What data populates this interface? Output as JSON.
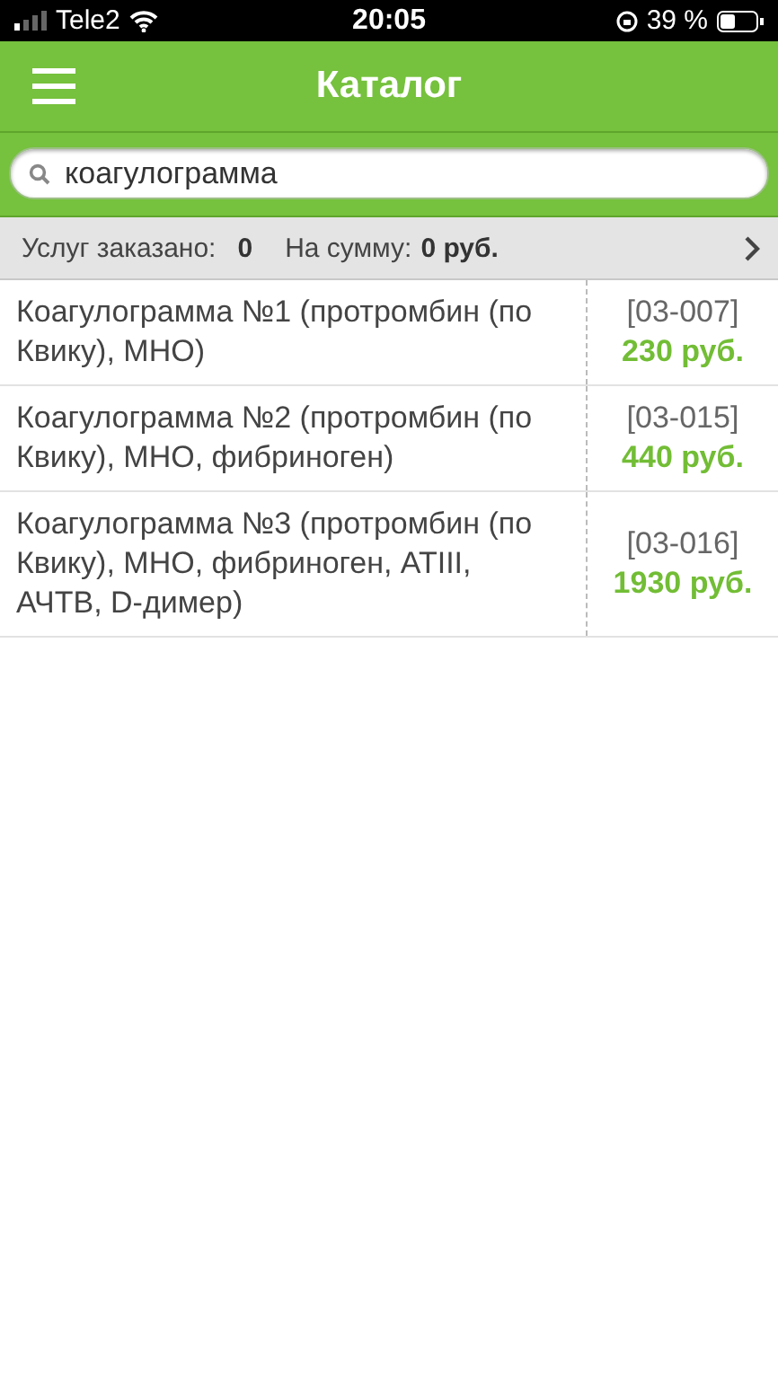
{
  "status_bar": {
    "carrier": "Tele2",
    "time": "20:05",
    "battery": "39 %"
  },
  "header": {
    "title": "Каталог"
  },
  "search": {
    "value": "коагулограмма"
  },
  "summary": {
    "ordered_label": "Услуг заказано:",
    "ordered_value": "0",
    "sum_label": "На сумму:",
    "sum_value": "0 руб."
  },
  "items": [
    {
      "name": "Коагулограмма №1 (протромбин (по Квику), МНО)",
      "code": "[03-007]",
      "price": "230 руб."
    },
    {
      "name": "Коагулограмма №2 (протромбин (по Квику), МНО, фибриноген)",
      "code": "[03-015]",
      "price": "440 руб."
    },
    {
      "name": "Коагулограмма №3 (протромбин (по Квику), МНО, фибриноген, ATIII, АЧТВ, D-димер)",
      "code": "[03-016]",
      "price": "1930 руб."
    }
  ]
}
